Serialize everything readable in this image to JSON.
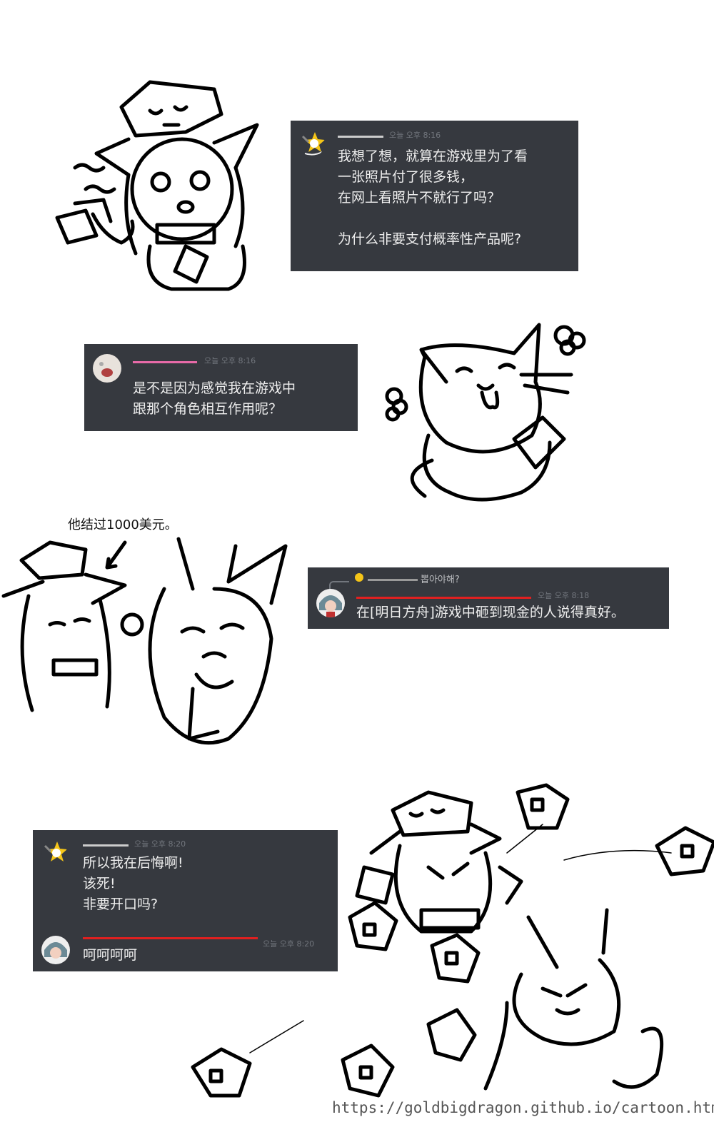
{
  "colors": {
    "bubble_bg": "#36393f",
    "text": "#eeeeee",
    "timestamp": "#72767d",
    "name_red": "#e02020",
    "name_pink": "#e86aa8"
  },
  "panel1": {
    "timestamp": "오늘 오후 8:16",
    "lines": "我想了想，就算在游戏里为了看\n一张照片付了很多钱，\n在网上看照片不就行了吗？\n\n为什么非要支付概率性产品呢?",
    "avatar": "yellow-star-character-avatar"
  },
  "panel2": {
    "timestamp": "오늘 오후 8:16",
    "lines": "是不是因为感觉我在游戏中\n跟那个角色相互作用呢？",
    "avatar": "cat-avatar"
  },
  "panel3": {
    "caption": "他结过1000美元。",
    "reply_text": "뽑아야해?",
    "timestamp": "오늘 오후 8:18",
    "lines": "在[明日方舟]游戏中砸到现金的人说得真好。",
    "avatar": "gray-hair-girl-avatar"
  },
  "panel4": {
    "msg1": {
      "timestamp": "오늘 오후 8:20",
      "lines": "所以我在后悔啊!\n该死!\n非要开口吗?"
    },
    "msg2": {
      "timestamp": "오늘 오후 8:20",
      "lines": "呵呵呵呵"
    }
  },
  "watermark": "https://goldbigdragon.github.io/cartoon.html"
}
